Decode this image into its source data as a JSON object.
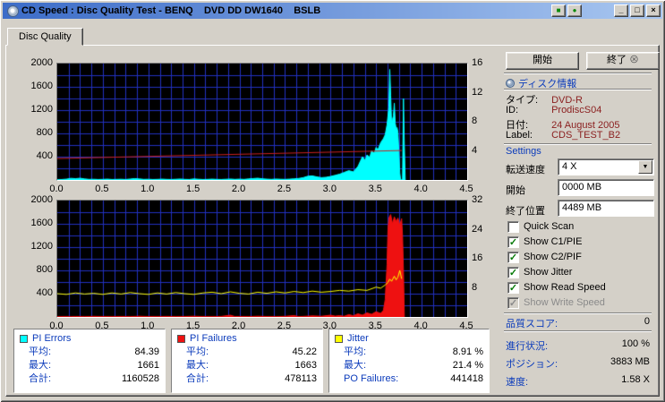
{
  "window": {
    "title": "CD Speed : Disc Quality Test - BENQ    DVD DD DW1640    BSLB",
    "title_icons": [
      {
        "name": "chart-icon",
        "glyph": "■"
      },
      {
        "name": "disc-record-icon",
        "glyph": "●"
      }
    ],
    "controls": [
      {
        "name": "minimize",
        "glyph": "_"
      },
      {
        "name": "maximize",
        "glyph": "□"
      },
      {
        "name": "close",
        "glyph": "×"
      }
    ]
  },
  "tab": {
    "label": "Disc Quality"
  },
  "buttons": {
    "start_label": "開始",
    "stop_label": "終了",
    "stop_glyph": "⊗"
  },
  "icons": {
    "check_glyph": "✓",
    "combo_arrow_glyph": "▼"
  },
  "colors": {
    "section_header": "#0b3bbb",
    "info_value": "#8b2020",
    "chart_grid": "#2230c0",
    "pi_errors": "#00ffff",
    "pi_failures": "#ee1111",
    "jitter": "#ffff00",
    "read_speed": "#cc2020"
  },
  "disc_info": {
    "header": "ディスク情報",
    "rows": [
      {
        "label": "タイプ:",
        "value": "DVD-R"
      },
      {
        "label": "ID:",
        "value": "ProdiscS04"
      },
      {
        "label": "日付:",
        "value": "24 August 2005"
      },
      {
        "label": "Label:",
        "value": "CDS_TEST_B2"
      }
    ]
  },
  "settings": {
    "header": "Settings",
    "speed_label": "転送速度",
    "speed_value": "4 X",
    "start_label": "開始",
    "start_value": "0000 MB",
    "end_label": "終了位置",
    "end_value": "4489 MB",
    "checkboxes": [
      {
        "label": "Quick Scan",
        "checked": false,
        "enabled": true
      },
      {
        "label": "Show C1/PIE",
        "checked": true,
        "enabled": true
      },
      {
        "label": "Show C2/PIF",
        "checked": true,
        "enabled": true
      },
      {
        "label": "Show Jitter",
        "checked": true,
        "enabled": true
      },
      {
        "label": "Show Read Speed",
        "checked": true,
        "enabled": true
      },
      {
        "label": "Show Write Speed",
        "checked": true,
        "enabled": false
      }
    ]
  },
  "score": {
    "label": "品質スコア:",
    "value": "0"
  },
  "progress": [
    {
      "label": "進行状況:",
      "value": "100 %"
    },
    {
      "label": "ポジション:",
      "value": "3883 MB"
    },
    {
      "label": "速度:",
      "value": "1.58 X"
    }
  ],
  "stats": [
    {
      "title": "PI Errors",
      "swatch": "#00ffff",
      "rows": [
        [
          "平均:",
          "84.39"
        ],
        [
          "最大:",
          "1661"
        ],
        [
          "合計:",
          "1160528"
        ]
      ]
    },
    {
      "title": "PI Failures",
      "swatch": "#ee1111",
      "rows": [
        [
          "平均:",
          "45.22"
        ],
        [
          "最大:",
          "1663"
        ],
        [
          "合計:",
          "478113"
        ]
      ]
    },
    {
      "title": "Jitter",
      "swatch": "#ffff00",
      "rows": [
        [
          "平均:",
          "8.91 %"
        ],
        [
          "最大:",
          "21.4 %"
        ],
        [
          "PO Failures:",
          "441418"
        ]
      ]
    }
  ],
  "chart_data": [
    {
      "type": "area",
      "name": "PI Errors / Read Speed",
      "xlabel": "",
      "ylabel": "",
      "xlim": [
        0,
        4.5
      ],
      "ylim_left": [
        0,
        2000
      ],
      "ylim_right": [
        0,
        16
      ],
      "xticks": [
        "0.0",
        "0.5",
        "1.0",
        "1.5",
        "2.0",
        "2.5",
        "3.0",
        "3.5",
        "4.0",
        "4.5"
      ],
      "yticks_left": [
        2000,
        1600,
        1200,
        800,
        400
      ],
      "yticks_right": [
        16,
        12,
        8,
        4
      ],
      "grid": {
        "x_step": 0.125,
        "y_step": 200,
        "color": "#2230c0"
      },
      "series": [
        {
          "name": "PI Errors",
          "type": "area",
          "axis": "left",
          "color": "#00ffff",
          "points": [
            [
              0,
              4
            ],
            [
              0.05,
              8
            ],
            [
              0.1,
              14
            ],
            [
              0.15,
              28
            ],
            [
              0.2,
              22
            ],
            [
              0.25,
              30
            ],
            [
              0.3,
              18
            ],
            [
              0.35,
              10
            ],
            [
              0.4,
              12
            ],
            [
              0.45,
              8
            ],
            [
              0.5,
              10
            ],
            [
              0.55,
              14
            ],
            [
              0.6,
              8
            ],
            [
              0.65,
              10
            ],
            [
              0.7,
              12
            ],
            [
              0.75,
              8
            ],
            [
              0.8,
              16
            ],
            [
              0.85,
              24
            ],
            [
              0.9,
              18
            ],
            [
              0.95,
              10
            ],
            [
              1,
              12
            ],
            [
              1.05,
              8
            ],
            [
              1.1,
              10
            ],
            [
              1.15,
              14
            ],
            [
              1.2,
              10
            ],
            [
              1.25,
              8
            ],
            [
              1.3,
              12
            ],
            [
              1.35,
              16
            ],
            [
              1.4,
              10
            ],
            [
              1.45,
              8
            ],
            [
              1.5,
              18
            ],
            [
              1.55,
              12
            ],
            [
              1.6,
              8
            ],
            [
              1.65,
              10
            ],
            [
              1.7,
              14
            ],
            [
              1.75,
              10
            ],
            [
              1.8,
              8
            ],
            [
              1.85,
              12
            ],
            [
              1.9,
              16
            ],
            [
              1.95,
              10
            ],
            [
              2,
              14
            ],
            [
              2.05,
              10
            ],
            [
              2.1,
              18
            ],
            [
              2.15,
              24
            ],
            [
              2.2,
              30
            ],
            [
              2.25,
              20
            ],
            [
              2.3,
              14
            ],
            [
              2.35,
              10
            ],
            [
              2.4,
              16
            ],
            [
              2.45,
              12
            ],
            [
              2.5,
              10
            ],
            [
              2.55,
              14
            ],
            [
              2.6,
              20
            ],
            [
              2.65,
              26
            ],
            [
              2.7,
              40
            ],
            [
              2.75,
              64
            ],
            [
              2.8,
              70
            ],
            [
              2.85,
              52
            ],
            [
              2.9,
              40
            ],
            [
              2.95,
              46
            ],
            [
              3,
              60
            ],
            [
              3.05,
              80
            ],
            [
              3.1,
              100
            ],
            [
              3.15,
              130
            ],
            [
              3.2,
              160
            ],
            [
              3.25,
              140
            ],
            [
              3.3,
              230
            ],
            [
              3.35,
              400
            ],
            [
              3.38,
              340
            ],
            [
              3.4,
              430
            ],
            [
              3.43,
              390
            ],
            [
              3.45,
              500
            ],
            [
              3.48,
              460
            ],
            [
              3.5,
              560
            ],
            [
              3.52,
              520
            ],
            [
              3.55,
              640
            ],
            [
              3.58,
              710
            ],
            [
              3.6,
              780
            ],
            [
              3.62,
              950
            ],
            [
              3.64,
              1250
            ],
            [
              3.65,
              1900
            ],
            [
              3.66,
              1450
            ],
            [
              3.67,
              980
            ],
            [
              3.68,
              1040
            ],
            [
              3.69,
              1100
            ],
            [
              3.7,
              1320
            ],
            [
              3.71,
              980
            ],
            [
              3.72,
              880
            ],
            [
              3.73,
              900
            ],
            [
              3.74,
              820
            ],
            [
              3.75,
              500
            ],
            [
              3.76,
              120
            ],
            [
              3.77,
              0
            ],
            [
              3.79,
              0
            ],
            [
              3.8,
              1400
            ],
            [
              3.81,
              600
            ],
            [
              3.82,
              0
            ]
          ]
        },
        {
          "name": "Read Speed",
          "type": "line",
          "axis": "right",
          "color": "#cc2020",
          "points": [
            [
              0,
              2.95
            ],
            [
              3.78,
              4.05
            ]
          ]
        }
      ]
    },
    {
      "type": "area",
      "name": "PI Failures / Jitter",
      "xlabel": "",
      "ylabel": "",
      "xlim": [
        0,
        4.5
      ],
      "ylim_left": [
        0,
        2000
      ],
      "ylim_right": [
        0,
        32
      ],
      "xticks": [
        "0.0",
        "0.5",
        "1.0",
        "1.5",
        "2.0",
        "2.5",
        "3.0",
        "3.5",
        "4.0",
        "4.5"
      ],
      "yticks_left": [
        2000,
        1600,
        1200,
        800,
        400
      ],
      "yticks_right": [
        32,
        24,
        16,
        8
      ],
      "grid": {
        "x_step": 0.125,
        "y_step": 200,
        "color": "#2230c0"
      },
      "series": [
        {
          "name": "PI Failures",
          "type": "area",
          "axis": "left",
          "color": "#ee1111",
          "points": [
            [
              0,
              2
            ],
            [
              0.1,
              6
            ],
            [
              0.15,
              2
            ],
            [
              0.2,
              8
            ],
            [
              0.3,
              4
            ],
            [
              0.4,
              10
            ],
            [
              0.5,
              6
            ],
            [
              0.6,
              3
            ],
            [
              0.7,
              8
            ],
            [
              0.8,
              5
            ],
            [
              0.9,
              12
            ],
            [
              1,
              6
            ],
            [
              1.1,
              4
            ],
            [
              1.2,
              9
            ],
            [
              1.3,
              5
            ],
            [
              1.4,
              7
            ],
            [
              1.5,
              12
            ],
            [
              1.6,
              6
            ],
            [
              1.7,
              4
            ],
            [
              1.8,
              9
            ],
            [
              1.9,
              30
            ],
            [
              1.95,
              6
            ],
            [
              2,
              8
            ],
            [
              2.1,
              5
            ],
            [
              2.2,
              12
            ],
            [
              2.3,
              7
            ],
            [
              2.4,
              5
            ],
            [
              2.5,
              10
            ],
            [
              2.6,
              24
            ],
            [
              2.65,
              6
            ],
            [
              2.7,
              9
            ],
            [
              2.8,
              18
            ],
            [
              2.9,
              12
            ],
            [
              3,
              30
            ],
            [
              3.05,
              14
            ],
            [
              3.1,
              22
            ],
            [
              3.15,
              12
            ],
            [
              3.2,
              40
            ],
            [
              3.25,
              20
            ],
            [
              3.3,
              55
            ],
            [
              3.35,
              30
            ],
            [
              3.4,
              70
            ],
            [
              3.45,
              45
            ],
            [
              3.5,
              90
            ],
            [
              3.55,
              60
            ],
            [
              3.58,
              110
            ],
            [
              3.6,
              300
            ],
            [
              3.62,
              900
            ],
            [
              3.63,
              1500
            ],
            [
              3.64,
              1700
            ],
            [
              3.66,
              1760
            ],
            [
              3.68,
              1600
            ],
            [
              3.7,
              1720
            ],
            [
              3.72,
              1640
            ],
            [
              3.74,
              1700
            ],
            [
              3.76,
              1580
            ],
            [
              3.78,
              1690
            ],
            [
              3.79,
              1400
            ],
            [
              3.8,
              800
            ],
            [
              3.81,
              0
            ]
          ]
        },
        {
          "name": "Jitter",
          "type": "line",
          "axis": "right",
          "color": "#ffff00",
          "points": [
            [
              0,
              6.4
            ],
            [
              0.1,
              6.2
            ],
            [
              0.2,
              6.6
            ],
            [
              0.3,
              6.3
            ],
            [
              0.4,
              6.5
            ],
            [
              0.5,
              6.2
            ],
            [
              0.6,
              6.6
            ],
            [
              0.7,
              6.3
            ],
            [
              0.8,
              6.7
            ],
            [
              0.9,
              6.4
            ],
            [
              1,
              6.2
            ],
            [
              1.1,
              6.6
            ],
            [
              1.2,
              6.3
            ],
            [
              1.3,
              6.7
            ],
            [
              1.4,
              6.4
            ],
            [
              1.5,
              6.2
            ],
            [
              1.6,
              6.6
            ],
            [
              1.7,
              6.8
            ],
            [
              1.8,
              6.4
            ],
            [
              1.9,
              6.9
            ],
            [
              2,
              6.5
            ],
            [
              2.1,
              6.3
            ],
            [
              2.2,
              6.8
            ],
            [
              2.3,
              6.5
            ],
            [
              2.4,
              6.9
            ],
            [
              2.5,
              6.6
            ],
            [
              2.6,
              7
            ],
            [
              2.7,
              6.7
            ],
            [
              2.8,
              7.1
            ],
            [
              2.9,
              6.8
            ],
            [
              3,
              7
            ],
            [
              3.1,
              7.3
            ],
            [
              3.2,
              7.1
            ],
            [
              3.3,
              7.5
            ],
            [
              3.4,
              7.3
            ],
            [
              3.5,
              8.2
            ],
            [
              3.55,
              7.9
            ],
            [
              3.6,
              8.8
            ],
            [
              3.63,
              9.5
            ],
            [
              3.65,
              10.4
            ],
            [
              3.67,
              9.8
            ],
            [
              3.7,
              11.2
            ],
            [
              3.72,
              10.2
            ],
            [
              3.74,
              11
            ],
            [
              3.76,
              12.8
            ],
            [
              3.78,
              10.5
            ]
          ]
        }
      ]
    }
  ]
}
